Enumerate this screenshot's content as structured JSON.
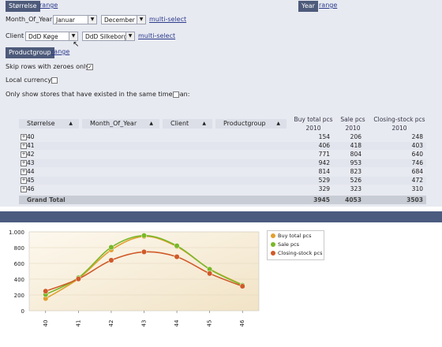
{
  "filters": {
    "storrelse_btn": "Størrelse",
    "storrelse_range": "range",
    "year_btn": "Year",
    "year_range": "range",
    "month_label": "Month_Of_Year",
    "month_from": "Januar",
    "month_to": "December",
    "month_multiselect": "multi-select",
    "client_label": "Client",
    "client_from": "DdD Køge",
    "client_to": "DdD Silkeborg",
    "client_multiselect": "multi-select",
    "productgroup_btn": "Productgroup",
    "productgroup_range": "range",
    "skip_zero_label": "Skip rows with zeroes only:",
    "skip_zero_checked": true,
    "local_currency_label": "Local currency:",
    "local_currency_checked": false,
    "same_timespan_label": "Only show stores that have existed in the same timespan:",
    "same_timespan_checked": false
  },
  "table": {
    "dim_headers": [
      "Størrelse",
      "Month_Of_Year",
      "Client",
      "Productgroup"
    ],
    "measure_headers": [
      {
        "name": "Buy total pcs",
        "year": "2010"
      },
      {
        "name": "Sale pcs",
        "year": "2010"
      },
      {
        "name": "Closing-stock pcs",
        "year": "2010"
      }
    ],
    "rows": [
      {
        "size": "40",
        "buy": "154",
        "sale": "206",
        "stock": "248"
      },
      {
        "size": "41",
        "buy": "406",
        "sale": "418",
        "stock": "403"
      },
      {
        "size": "42",
        "buy": "771",
        "sale": "804",
        "stock": "640"
      },
      {
        "size": "43",
        "buy": "942",
        "sale": "953",
        "stock": "746"
      },
      {
        "size": "44",
        "buy": "814",
        "sale": "823",
        "stock": "684"
      },
      {
        "size": "45",
        "buy": "529",
        "sale": "526",
        "stock": "472"
      },
      {
        "size": "46",
        "buy": "329",
        "sale": "323",
        "stock": "310"
      }
    ],
    "total": {
      "label": "Grand Total",
      "buy": "3945",
      "sale": "4053",
      "stock": "3503"
    }
  },
  "chart_data": {
    "type": "line",
    "categories": [
      "40",
      "41",
      "42",
      "43",
      "44",
      "45",
      "46"
    ],
    "series": [
      {
        "name": "Buy total pcs",
        "color": "#e0a030",
        "values": [
          154,
          406,
          771,
          942,
          814,
          529,
          329
        ]
      },
      {
        "name": "Sale pcs",
        "color": "#7ab828",
        "values": [
          206,
          418,
          804,
          953,
          823,
          526,
          323
        ]
      },
      {
        "name": "Closing-stock pcs",
        "color": "#d05a28",
        "values": [
          248,
          403,
          640,
          746,
          684,
          472,
          310
        ]
      }
    ],
    "yticks": [
      "0",
      "200",
      "400",
      "600",
      "800",
      "1.000"
    ],
    "ylim": [
      0,
      1000
    ],
    "grid": true,
    "legend": "right"
  }
}
